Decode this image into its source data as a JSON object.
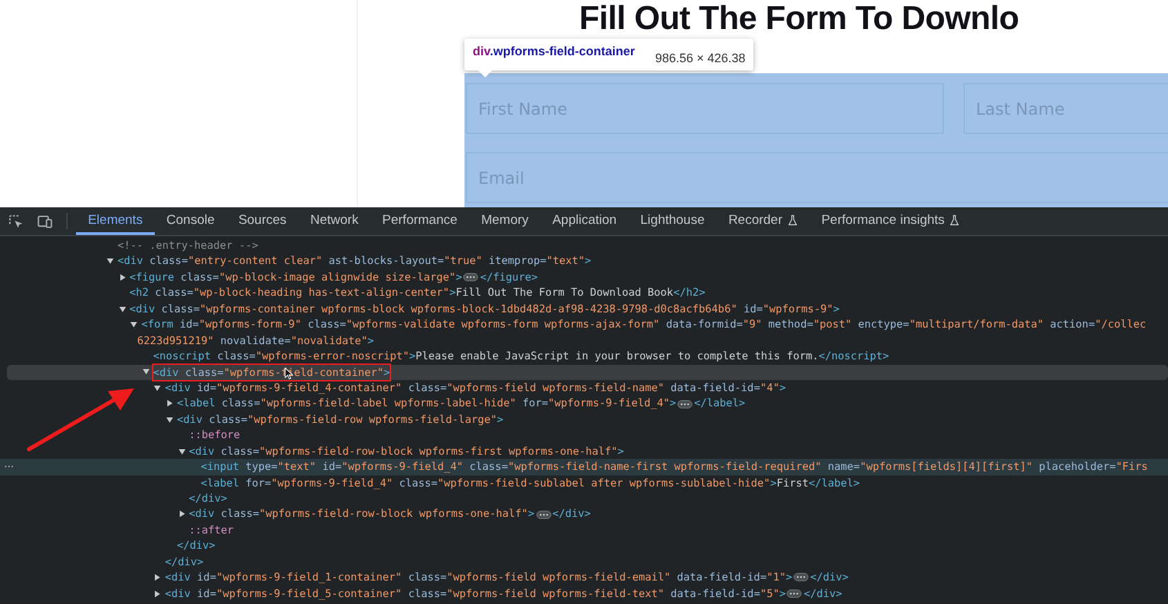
{
  "page": {
    "heading": "Fill Out The Form To Downlo",
    "fields": [
      {
        "placeholder": "First Name"
      },
      {
        "placeholder": "Last Name"
      },
      {
        "placeholder": "Email"
      }
    ]
  },
  "inspect_tooltip": {
    "tag": "div",
    "selector": ".wpforms-field-container",
    "size": "986.56 × 426.38"
  },
  "devtools": {
    "tabs": [
      {
        "label": "Elements",
        "selected": true,
        "experimental": false
      },
      {
        "label": "Console",
        "selected": false,
        "experimental": false
      },
      {
        "label": "Sources",
        "selected": false,
        "experimental": false
      },
      {
        "label": "Network",
        "selected": false,
        "experimental": false
      },
      {
        "label": "Performance",
        "selected": false,
        "experimental": false
      },
      {
        "label": "Memory",
        "selected": false,
        "experimental": false
      },
      {
        "label": "Application",
        "selected": false,
        "experimental": false
      },
      {
        "label": "Lighthouse",
        "selected": false,
        "experimental": false
      },
      {
        "label": "Recorder",
        "selected": false,
        "experimental": true
      },
      {
        "label": "Performance insights",
        "selected": false,
        "experimental": true
      }
    ],
    "tree": [
      {
        "kind": "comment",
        "open": "<!-- .entry-header -->",
        "selected": false,
        "hovered": false
      },
      {
        "kind": "element",
        "open": "<div class=\"entry-content clear\" ast-blocks-layout=\"true\" itemprop=\"text\">",
        "expanded": true,
        "selected": false,
        "hovered": false,
        "children": [
          {
            "kind": "element",
            "open": "<figure class=\"wp-block-image alignwide size-large\">",
            "close": "</figure>",
            "expanded": false,
            "selected": false,
            "hovered": false
          },
          {
            "kind": "leaf",
            "open": "<h2 class=\"wp-block-heading has-text-align-center\">Fill Out The Form To Download Book</h2>",
            "selected": false,
            "hovered": false
          },
          {
            "kind": "element",
            "open": "<div class=\"wpforms-container wpforms-block wpforms-block-1dbd482d-af98-4238-9798-d0c8acfb64b6\" id=\"wpforms-9\">",
            "expanded": true,
            "selected": false,
            "hovered": false,
            "children": [
              {
                "kind": "element",
                "open": "<form id=\"wpforms-form-9\" class=\"wpforms-validate wpforms-form wpforms-ajax-form\" data-formid=\"9\" method=\"post\" enctype=\"multipart/form-data\" action=\"/collec",
                "wrap": "6223d951219\" novalidate=\"novalidate\">",
                "expanded": true,
                "selected": false,
                "hovered": false,
                "children": [
                  {
                    "kind": "leaf",
                    "open": "<noscript class=\"wpforms-error-noscript\">Please enable JavaScript in your browser to complete this form.</noscript>",
                    "selected": false,
                    "hovered": false
                  },
                  {
                    "kind": "element",
                    "open": "<div class=\"wpforms-field-container\">",
                    "expanded": true,
                    "selected": false,
                    "hovered": true,
                    "annotated": true,
                    "children": [
                      {
                        "kind": "element",
                        "open": "<div id=\"wpforms-9-field_4-container\" class=\"wpforms-field wpforms-field-name\" data-field-id=\"4\">",
                        "close": "</div>",
                        "expanded": true,
                        "selected": false,
                        "hovered": false,
                        "children": [
                          {
                            "kind": "element",
                            "open": "<label class=\"wpforms-field-label wpforms-label-hide\" for=\"wpforms-9-field_4\">",
                            "close": "</label>",
                            "expanded": false,
                            "selected": false,
                            "hovered": false
                          },
                          {
                            "kind": "element",
                            "open": "<div class=\"wpforms-field-row wpforms-field-large\">",
                            "close": "</div>",
                            "expanded": true,
                            "selected": false,
                            "hovered": false,
                            "children": [
                              {
                                "kind": "pseudo",
                                "open": "::before",
                                "selected": false,
                                "hovered": false
                              },
                              {
                                "kind": "element",
                                "open": "<div class=\"wpforms-field-row-block wpforms-first wpforms-one-half\">",
                                "close": "</div>",
                                "expanded": true,
                                "selected": false,
                                "hovered": false,
                                "children": [
                                  {
                                    "kind": "leaf",
                                    "open": "<input type=\"text\" id=\"wpforms-9-field_4\" class=\"wpforms-field-name-first wpforms-field-required\" name=\"wpforms[fields][4][first]\" placeholder=\"Firs",
                                    "selected": true,
                                    "hovered": false
                                  },
                                  {
                                    "kind": "leaf",
                                    "open": "<label for=\"wpforms-9-field_4\" class=\"wpforms-field-sublabel after wpforms-sublabel-hide\">First</label>",
                                    "selected": false,
                                    "hovered": false
                                  }
                                ]
                              },
                              {
                                "kind": "element",
                                "open": "<div class=\"wpforms-field-row-block wpforms-one-half\">",
                                "close": "</div>",
                                "expanded": false,
                                "selected": false,
                                "hovered": false
                              },
                              {
                                "kind": "pseudo",
                                "open": "::after",
                                "selected": false,
                                "hovered": false
                              }
                            ]
                          }
                        ]
                      },
                      {
                        "kind": "element",
                        "open": "<div id=\"wpforms-9-field_1-container\" class=\"wpforms-field wpforms-field-email\" data-field-id=\"1\">",
                        "close": "</div>",
                        "expanded": false,
                        "selected": false,
                        "hovered": false
                      },
                      {
                        "kind": "element",
                        "open": "<div id=\"wpforms-9-field_5-container\" class=\"wpforms-field wpforms-field-text\" data-field-id=\"5\">",
                        "close": "</div>",
                        "expanded": false,
                        "selected": false,
                        "hovered": false
                      }
                    ]
                  }
                ]
              }
            ]
          }
        ]
      }
    ]
  }
}
